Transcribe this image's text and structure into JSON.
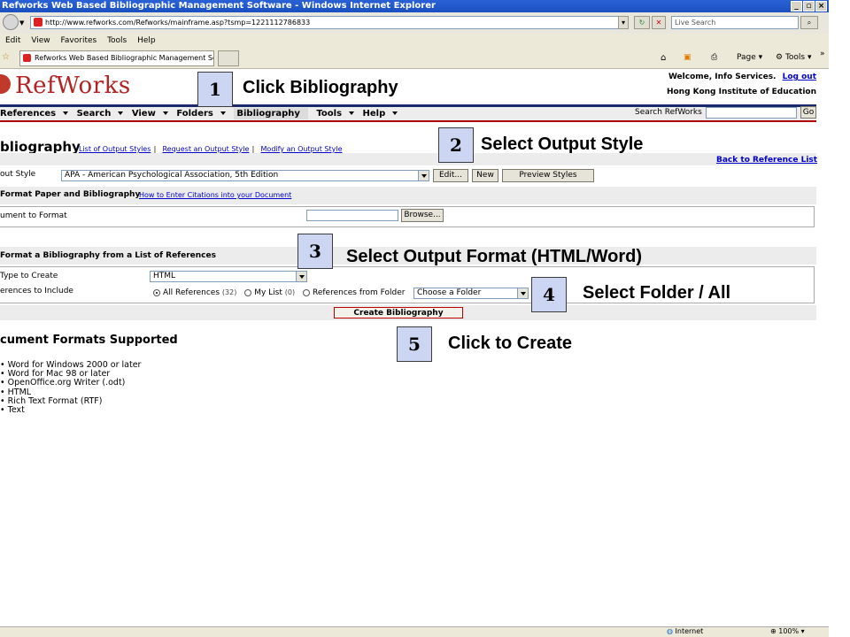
{
  "window": {
    "title": "Refworks Web Based Bibliographic Management Software - Windows Internet Explorer",
    "url": "http://www.refworks.com/Refworks/mainframe.asp?tsmp=1221112786833",
    "search_placeholder": "Live Search",
    "tab_title": "Refworks Web Based Bibliographic Management Soft...",
    "menu": [
      "Edit",
      "View",
      "Favorites",
      "Tools",
      "Help"
    ],
    "toolbar": {
      "page": "Page",
      "tools": "Tools"
    },
    "status": {
      "zone": "Internet",
      "zoom": "100%"
    }
  },
  "header": {
    "logo": "RefWorks",
    "welcome": "Welcome, Info Services.",
    "logout": "Log out",
    "institution": "Hong Kong Institute of Education"
  },
  "nav": {
    "items": [
      "References",
      "Search",
      "View",
      "Folders",
      "Bibliography",
      "Tools",
      "Help"
    ],
    "search_label": "Search RefWorks",
    "go": "Go"
  },
  "page": {
    "title": "bliography",
    "links": [
      "List of Output Styles",
      "Request an Output Style",
      "Modify an Output Style"
    ],
    "back_link": "Back to Reference List",
    "output_style_label": "out Style",
    "output_style_value": "APA - American Psychological Association, 5th Edition",
    "edit_btn": "Edit...",
    "new_btn": "New",
    "preview_btn": "Preview Styles",
    "format_paper_heading": "Format Paper and Bibliography",
    "format_paper_link": "How to Enter Citations into your Document",
    "doc_to_format_label": "ument to Format",
    "browse_btn": "Browse...",
    "format_list_heading": "Format a Bibliography from a List of References",
    "file_type_label": "Type to Create",
    "file_type_value": "HTML",
    "refs_label": "erences to Include",
    "radio_all": "All References",
    "radio_all_count": "(32)",
    "radio_mylist": "My List",
    "radio_mylist_count": "(0)",
    "radio_folder": "References from Folder",
    "folder_value": "Choose a Folder",
    "create_btn": "Create Bibliography",
    "formats_heading": "cument Formats Supported",
    "formats": [
      "Word for Windows 2000 or later",
      "Word for Mac 98 or later",
      "OpenOffice.org Writer (.odt)",
      "HTML",
      "Rich Text Format (RTF)",
      "Text"
    ]
  },
  "callouts": [
    {
      "num": "1",
      "text": "Click Bibliography"
    },
    {
      "num": "2",
      "text": "Select Output Style"
    },
    {
      "num": "3",
      "text": "Select Output Format (HTML/Word)"
    },
    {
      "num": "4",
      "text": "Select Folder / All"
    },
    {
      "num": "5",
      "text": "Click to Create"
    }
  ]
}
